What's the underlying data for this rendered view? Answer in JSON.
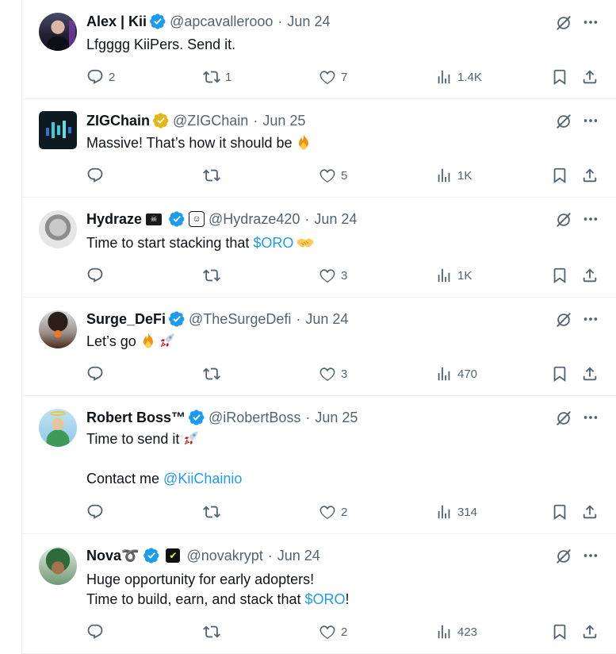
{
  "tweets": [
    {
      "name": "Alex | Kii",
      "handle": "@apcavallerooo",
      "date": "Jun 24",
      "verified": "blue",
      "lines": [
        "Lfgggg KiiPers. Send it."
      ],
      "replies": "2",
      "reposts": "1",
      "likes": "7",
      "views": "1.4K"
    },
    {
      "name": "ZIGChain",
      "handle": "@ZIGChain",
      "date": "Jun 25",
      "verified": "gold",
      "lines": [
        "Massive! That’s how it should be"
      ],
      "replies": "",
      "reposts": "",
      "likes": "5",
      "views": "1K"
    },
    {
      "name": "Hydraze",
      "handle": "@Hydraze420",
      "date": "Jun 24",
      "verified": "blue",
      "lines": [
        "Time to start stacking that ",
        "$ORO"
      ],
      "replies": "",
      "reposts": "",
      "likes": "3",
      "views": "1K"
    },
    {
      "name": "Surge_DeFi",
      "handle": "@TheSurgeDefi",
      "date": "Jun 24",
      "verified": "blue",
      "lines": [
        "Let’s go"
      ],
      "replies": "",
      "reposts": "",
      "likes": "3",
      "views": "470"
    },
    {
      "name": "Robert Boss™",
      "handle": "@iRobertBoss",
      "date": "Jun 25",
      "verified": "blue",
      "lines": [
        "Time to send it",
        "Contact me ",
        "@KiiChainio"
      ],
      "replies": "",
      "reposts": "",
      "likes": "2",
      "views": "314"
    },
    {
      "name": "Nova➰",
      "handle": "@novakrypt",
      "date": "Jun 24",
      "verified": "blue",
      "lines": [
        "Huge opportunity for early adopters!",
        "Time to build, earn, and stack that ",
        "$ORO",
        "!"
      ],
      "replies": "",
      "reposts": "",
      "likes": "2",
      "views": "423"
    }
  ],
  "icons": {
    "reply": "reply-icon",
    "repost": "repost-icon",
    "like": "heart-icon",
    "views": "views-icon",
    "bookmark": "bookmark-icon",
    "share": "share-icon",
    "grok": "grok-icon",
    "more": "more-icon"
  },
  "colors": {
    "text": "#0f1419",
    "secondary": "#536471",
    "link": "#1d9bf0",
    "verified_blue": "#1d9bf0",
    "verified_gold": "#e2b719",
    "divider": "#eff3f4"
  }
}
